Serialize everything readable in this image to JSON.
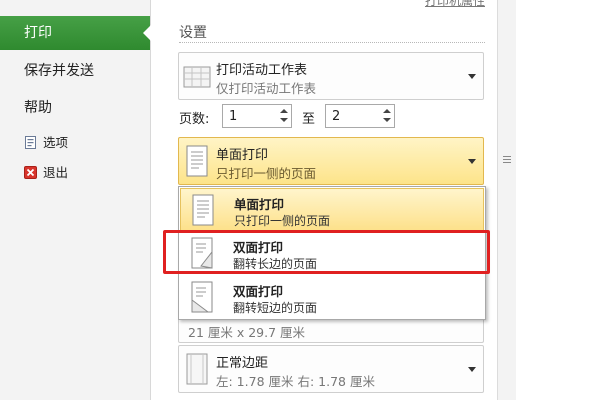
{
  "sidebar": {
    "items": [
      {
        "label": "打印"
      },
      {
        "label": "保存并发送"
      },
      {
        "label": "帮助"
      }
    ],
    "small_items": [
      {
        "label": "选项"
      },
      {
        "label": "退出"
      }
    ],
    "active_color": "#3c963c"
  },
  "main": {
    "printer_properties_link": "打印机属性",
    "section_title": "设置",
    "scope": {
      "title": "打印活动工作表",
      "subtitle": "仅打印活动工作表"
    },
    "pages": {
      "label": "页数:",
      "from_value": "1",
      "to_label": "至",
      "to_value": "2"
    },
    "duplex": {
      "title": "单面打印",
      "subtitle": "只打印一侧的页面"
    },
    "duplex_options": [
      {
        "title": "单面打印",
        "subtitle": "只打印一侧的页面",
        "selected": true
      },
      {
        "title": "双面打印",
        "subtitle": "翻转长边的页面",
        "selected": false
      },
      {
        "title": "双面打印",
        "subtitle": "翻转短边的页面",
        "selected": false
      }
    ],
    "paper_size_partial": "21 厘米 x 29.7 厘米",
    "margins": {
      "title": "正常边距",
      "subtitle": "左:  1.78 厘米    右:  1.78 厘米"
    }
  },
  "colors": {
    "highlight": "#fde48a",
    "annotation_box": "#e02020"
  }
}
